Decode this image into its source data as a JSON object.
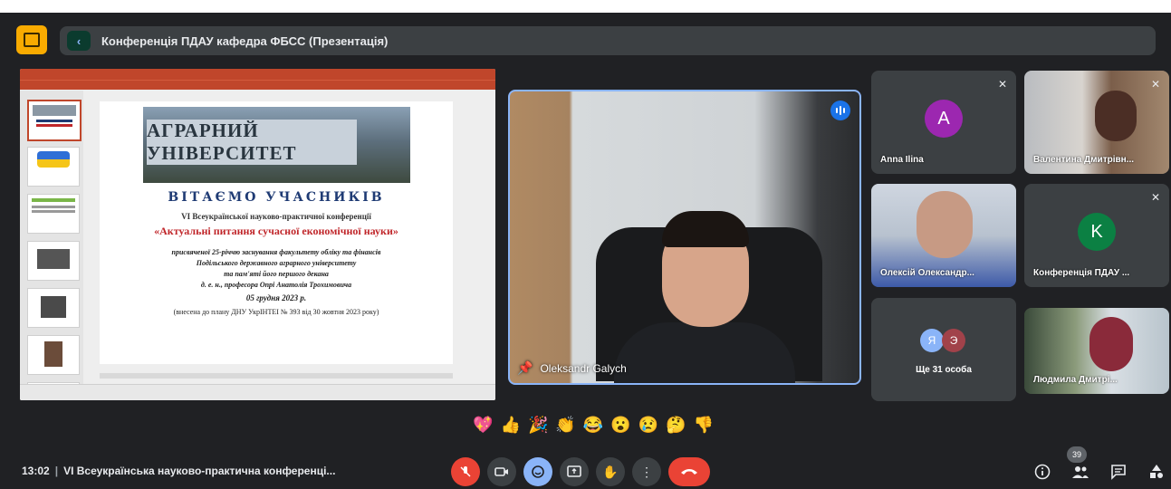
{
  "presentation": {
    "title": "Конференція ПДАУ кафедра ФБСС (Презентація)",
    "slide": {
      "sign_text": "АГРАРНИЙ УНІВЕРСИТЕТ",
      "heading": "ВІТАЄМО УЧАСНИКІВ",
      "subheading": "VI Всеукраїнської науково-практичної конференції",
      "conference_title": "«Актуальні питання сучасної економічної науки»",
      "line1": "присвяченої 25-річчю заснування факультету обліку та фінансів",
      "line2": "Подільського державного аграрного університету",
      "line3": "та пам'яті його першого декана",
      "line4": "д. е. н., професора Опрі Анатолія Трохимовича",
      "date": "05 грудня 2023 р.",
      "note": "(внесена до плану ДНУ УкрІНТЕІ № 393 від 30 жовтня 2023 року)"
    }
  },
  "speaker": {
    "name": "Oleksandr Galych"
  },
  "participants": [
    {
      "name": "Anna Ilina",
      "initial": "A",
      "avatar_color": "#9c27b0"
    },
    {
      "name": "Валентина Дмитрівн..."
    },
    {
      "name": "Олексій Олександр..."
    },
    {
      "name": "Конференція ПДАУ ...",
      "initial": "K",
      "avatar_color": "#0b8043"
    },
    {
      "name": "Ще 31 особа",
      "initials": [
        "Я",
        "Э"
      ]
    },
    {
      "name": "Людмила Дмитрі..."
    }
  ],
  "reactions": [
    "💖",
    "👍",
    "🎉",
    "👏",
    "😂",
    "😮",
    "😢",
    "🤔",
    "👎"
  ],
  "bottom": {
    "time": "13:02",
    "separator": "|",
    "meeting_name": "VI Всеукраїнська науково-практична конференці...",
    "participant_count": "39"
  },
  "colors": {
    "accent": "#8ab4f8",
    "danger": "#ea4335",
    "surface": "#3c4043",
    "background": "#202124"
  }
}
